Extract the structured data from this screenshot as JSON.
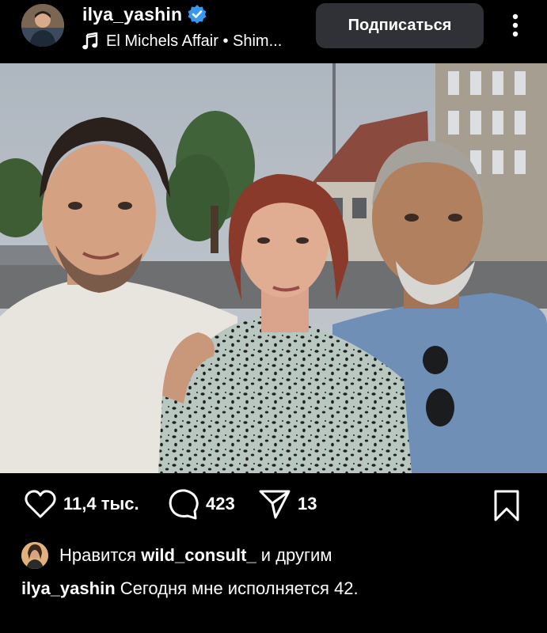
{
  "post": {
    "username": "ilya_yashin",
    "verified": true,
    "audio": "El Michels Affair • Shim...",
    "follow_label": "Подписаться",
    "icons": {
      "avatar": "profile-avatar",
      "verified": "verified-badge-icon",
      "audio": "music-note-icon",
      "more": "more-vertical-icon",
      "mute": "speaker-muted-icon",
      "like": "heart-icon",
      "comment": "comment-icon",
      "share": "send-icon",
      "save": "bookmark-icon"
    },
    "colors": {
      "background": "#000000",
      "button": "#2f3136",
      "verified_blue": "#3897f0",
      "text": "#ffffff"
    }
  },
  "actions": {
    "likes_count": "11,4 тыс.",
    "comments_count": "423",
    "shares_count": "13"
  },
  "likes": {
    "prefix": "Нравится ",
    "user": "wild_consult_",
    "suffix": " и другим"
  },
  "caption": {
    "author": "ilya_yashin",
    "text": " Сегодня мне исполняется 42."
  }
}
